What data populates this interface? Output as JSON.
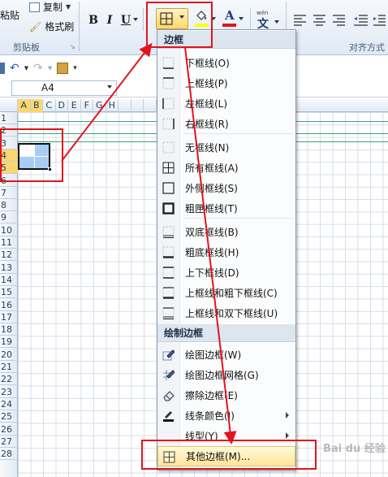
{
  "clipboard": {
    "paste_label": "粘贴",
    "copy_label": "复制",
    "format_painter_label": "格式刷",
    "group_label": "剪贴板"
  },
  "font": {
    "bold": "B",
    "italic": "I",
    "underline": "U",
    "color_letter": "A",
    "wen": "文",
    "accent_red": "#e2141c"
  },
  "alignment": {
    "group_label": "对齐方式"
  },
  "name_box": {
    "value": "A4"
  },
  "columns": [
    "A",
    "B",
    "C",
    "D",
    "E",
    "F",
    "G",
    "H",
    "",
    "",
    "",
    "",
    "",
    "",
    "",
    "Q",
    "R",
    "S",
    "T",
    "U",
    "V"
  ],
  "rows": [
    "1",
    "2",
    "3",
    "4",
    "5",
    "6",
    "7",
    "8",
    "9",
    "10",
    "11",
    "12",
    "13",
    "14",
    "15",
    "16",
    "17",
    "18",
    "19",
    "20",
    "21",
    "22",
    "23",
    "24",
    "25",
    "26",
    "27",
    "28"
  ],
  "menu": {
    "header_borders": "边框",
    "header_draw": "绘制边框",
    "items": [
      {
        "label": "下框线(O)"
      },
      {
        "label": "上框线(P)"
      },
      {
        "label": "左框线(L)"
      },
      {
        "label": "右框线(R)"
      },
      {
        "label": "无框线(N)"
      },
      {
        "label": "所有框线(A)"
      },
      {
        "label": "外侧框线(S)"
      },
      {
        "label": "粗匣框线(T)"
      },
      {
        "label": "双底框线(B)"
      },
      {
        "label": "粗底框线(H)"
      },
      {
        "label": "上下框线(D)"
      },
      {
        "label": "上框线和粗下框线(C)"
      },
      {
        "label": "上框线和双下框线(U)"
      }
    ],
    "draw_items": [
      {
        "label": "绘图边框(W)"
      },
      {
        "label": "绘图边框网格(G)"
      },
      {
        "label": "擦除边框(E)"
      },
      {
        "label": "线条颜色(I)"
      },
      {
        "label": "线型(Y)"
      }
    ],
    "more_borders": "其他边框(M)..."
  },
  "watermark": "Bai du 经验"
}
